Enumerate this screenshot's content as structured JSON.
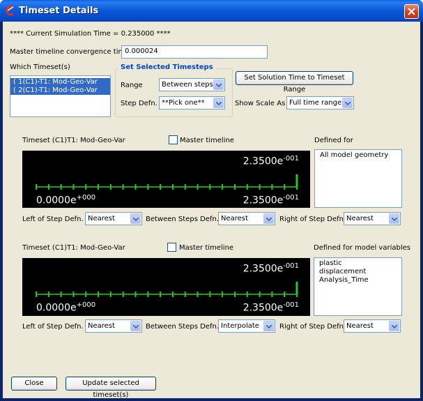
{
  "window": {
    "title": "Timeset Details"
  },
  "sim_time": "**** Current Simulation Time = 0.235000 ****",
  "convergence": {
    "label": "Master timeline convergence time",
    "value": "0.000024"
  },
  "which_timeset": {
    "label": "Which Timeset(s)",
    "items": [
      "( 1(C1)-T1: Mod-Geo-Var",
      "( 2(C1)-T1: Mod-Geo-Var"
    ]
  },
  "set_steps": {
    "title": "Set Selected Timesteps",
    "range_label": "Range",
    "range_value": "Between steps",
    "stepdefn_label": "Step Defn.",
    "stepdefn_value": "**Pick one**"
  },
  "set_solution_button": "Set Solution Time to Timeset Range",
  "show_scale": {
    "label": "Show Scale As",
    "value": "Full time range"
  },
  "timesets": [
    {
      "title": "Timeset (C1)T1: Mod-Geo-Var",
      "master_label": "Master timeline",
      "defined_label": "Defined for",
      "defined_items": [
        "All model geometry"
      ],
      "top_right_mant": "2.3500e",
      "top_right_exp": "-001",
      "bottom_left_mant": "0.0000e",
      "bottom_left_exp": "+000",
      "bottom_right_mant": "2.3500e",
      "bottom_right_exp": "-001",
      "current_step_fraction": 1.0,
      "left_label": "Left of Step Defn.",
      "left_value": "Nearest",
      "between_label": "Between Steps Defn.",
      "between_value": "Nearest",
      "right_label": "Right of Step Defn",
      "right_value": "Nearest"
    },
    {
      "title": "Timeset (C1)T1: Mod-Geo-Var",
      "master_label": "Master timeline",
      "defined_label": "Defined for model variables",
      "defined_items": [
        "plastic",
        "displacement",
        "Analysis_Time"
      ],
      "top_right_mant": "2.3500e",
      "top_right_exp": "-001",
      "bottom_left_mant": "0.0000e",
      "bottom_left_exp": "+000",
      "bottom_right_mant": "2.3500e",
      "bottom_right_exp": "-001",
      "current_step_fraction": 1.0,
      "left_label": "Left of Step Defn.",
      "left_value": "Nearest",
      "between_label": "Between Steps Defn.",
      "between_value": "Interpolate",
      "right_label": "Right of Step Defn",
      "right_value": "Nearest"
    }
  ],
  "close_button": "Close",
  "update_button": "Update selected timeset(s)",
  "colors": {
    "tick": "#22cc22",
    "timeline_bg": "#000000",
    "titlebar": "#0b5bd9",
    "selection": "#316ac5"
  }
}
